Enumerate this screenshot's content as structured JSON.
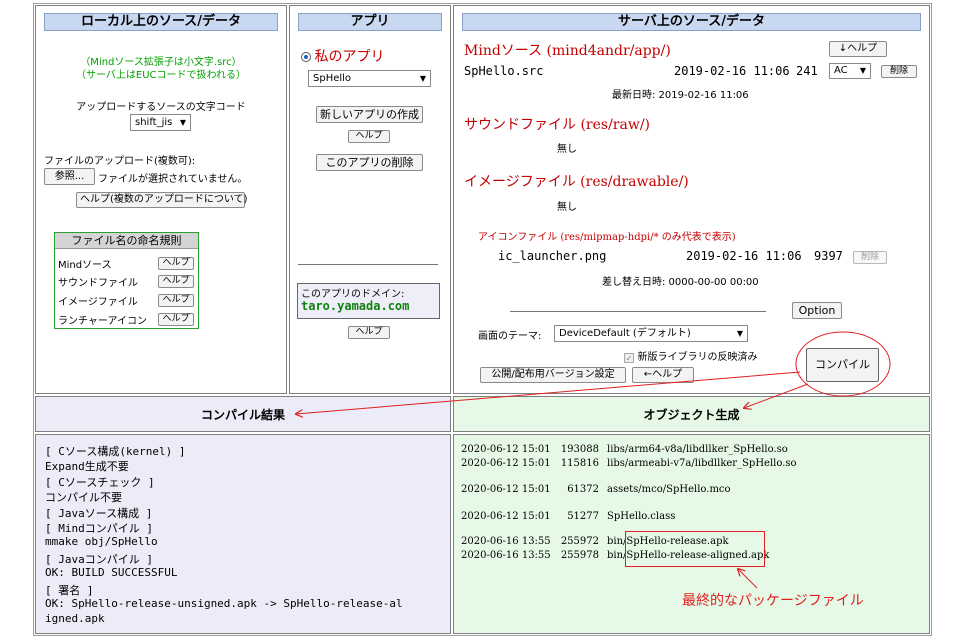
{
  "local": {
    "header": "ローカル上のソース/データ",
    "note1": "（Mindソース拡張子は小文字.src）",
    "note2": "（サーバ上はEUCコードで扱われる）",
    "encoding_label": "アップロードするソースの文字コード",
    "encoding_value": "shift_jis",
    "upload_label": "ファイルのアップロード(複数可):",
    "browse_button": "参照...",
    "no_file_text": "ファイルが選択されていません。",
    "help_multi_button": "ヘルプ(複数のアップロードについて)",
    "naming": {
      "title": "ファイル名の命名規則",
      "rows": [
        {
          "label": "Mindソース",
          "button": "ヘルプ"
        },
        {
          "label": "サウンドファイル",
          "button": "ヘルプ"
        },
        {
          "label": "イメージファイル",
          "button": "ヘルプ"
        },
        {
          "label": "ランチャーアイコン",
          "button": "ヘルプ"
        }
      ]
    }
  },
  "app": {
    "header": "アプリ",
    "radio_label": "私のアプリ",
    "selected_app": "SpHello",
    "new_app_button": "新しいアプリの作成",
    "help_button": "ヘルプ",
    "delete_app_button": "このアプリの削除",
    "domain_label": "このアプリのドメイン:",
    "domain_value": "taro.yamada.com",
    "domain_help_button": "ヘルプ"
  },
  "server": {
    "header": "サーバ上のソース/データ",
    "mind_title": "Mindソース (mind4andr/app/)",
    "help_button": "↓ヘルプ",
    "file_name": "SpHello.src",
    "file_date": "2019-02-16 11:06",
    "file_size": "241",
    "file_enc": "AC",
    "delete_button": "削除",
    "last_update": "最新日時: 2019-02-16 11:06",
    "sound_title": "サウンドファイル (res/raw/)",
    "sound_none": "無し",
    "image_title": "イメージファイル (res/drawable/)",
    "image_none": "無し",
    "icon_title": "アイコンファイル (res/mipmap-hdpi/* のみ代表で表示)",
    "icon_file": "ic_launcher.png",
    "icon_date": "2019-02-16 11:06",
    "icon_size": "9397",
    "icon_delete_button": "削除",
    "replace_date": "差し替え日時: 0000-00-00 00:00",
    "option_button": "Option",
    "theme_label": "画面のテーマ:",
    "theme_value": "DeviceDefault (デフォルト)",
    "newlib_label": "新版ライブラリの反映済み",
    "version_button": "公開/配布用バージョン設定",
    "back_help_button": "←ヘルプ",
    "compile_button": "コンパイル"
  },
  "compile": {
    "header": "コンパイル結果",
    "lines": [
      "[ Cソース構成(kernel) ]",
      "    Expand生成不要",
      "[ Cソースチェック ]",
      "    コンパイル不要",
      "[ Javaソース構成 ]",
      "[ Mindコンパイル ]",
      "    mmake obj/SpHello",
      "[ Javaコンパイル ]",
      "    OK: BUILD SUCCESSFUL",
      "[ 署名 ]",
      "    OK: SpHello-release-unsigned.apk -> SpHello-release-al",
      "igned.apk"
    ]
  },
  "objects": {
    "header": "オブジェクト生成",
    "files": [
      {
        "date": "2020-06-12 15:01",
        "size": "193088",
        "path": "libs/arm64-v8a/libdllker_SpHello.so"
      },
      {
        "date": "2020-06-12 15:01",
        "size": "115816",
        "path": "libs/armeabi-v7a/libdllker_SpHello.so"
      },
      {
        "date": "2020-06-12 15:01",
        "size": "61372",
        "path": "assets/mco/SpHello.mco"
      },
      {
        "date": "2020-06-12 15:01",
        "size": "51277",
        "path": "SpHello.class"
      },
      {
        "date": "2020-06-16 13:55",
        "size": "255972",
        "path": "bin/SpHello-release.apk"
      },
      {
        "date": "2020-06-16 13:55",
        "size": "255978",
        "path": "bin/SpHello-release-aligned.apk"
      }
    ],
    "annotation": "最終的なパッケージファイル"
  },
  "colors": {
    "header_bg": "#c8d8f0",
    "lower_left_bg": "#ececf8",
    "lower_right_bg": "#e6f8e6",
    "annotation_red": "#e02020",
    "domain_box_bg": "#eeeef8"
  }
}
